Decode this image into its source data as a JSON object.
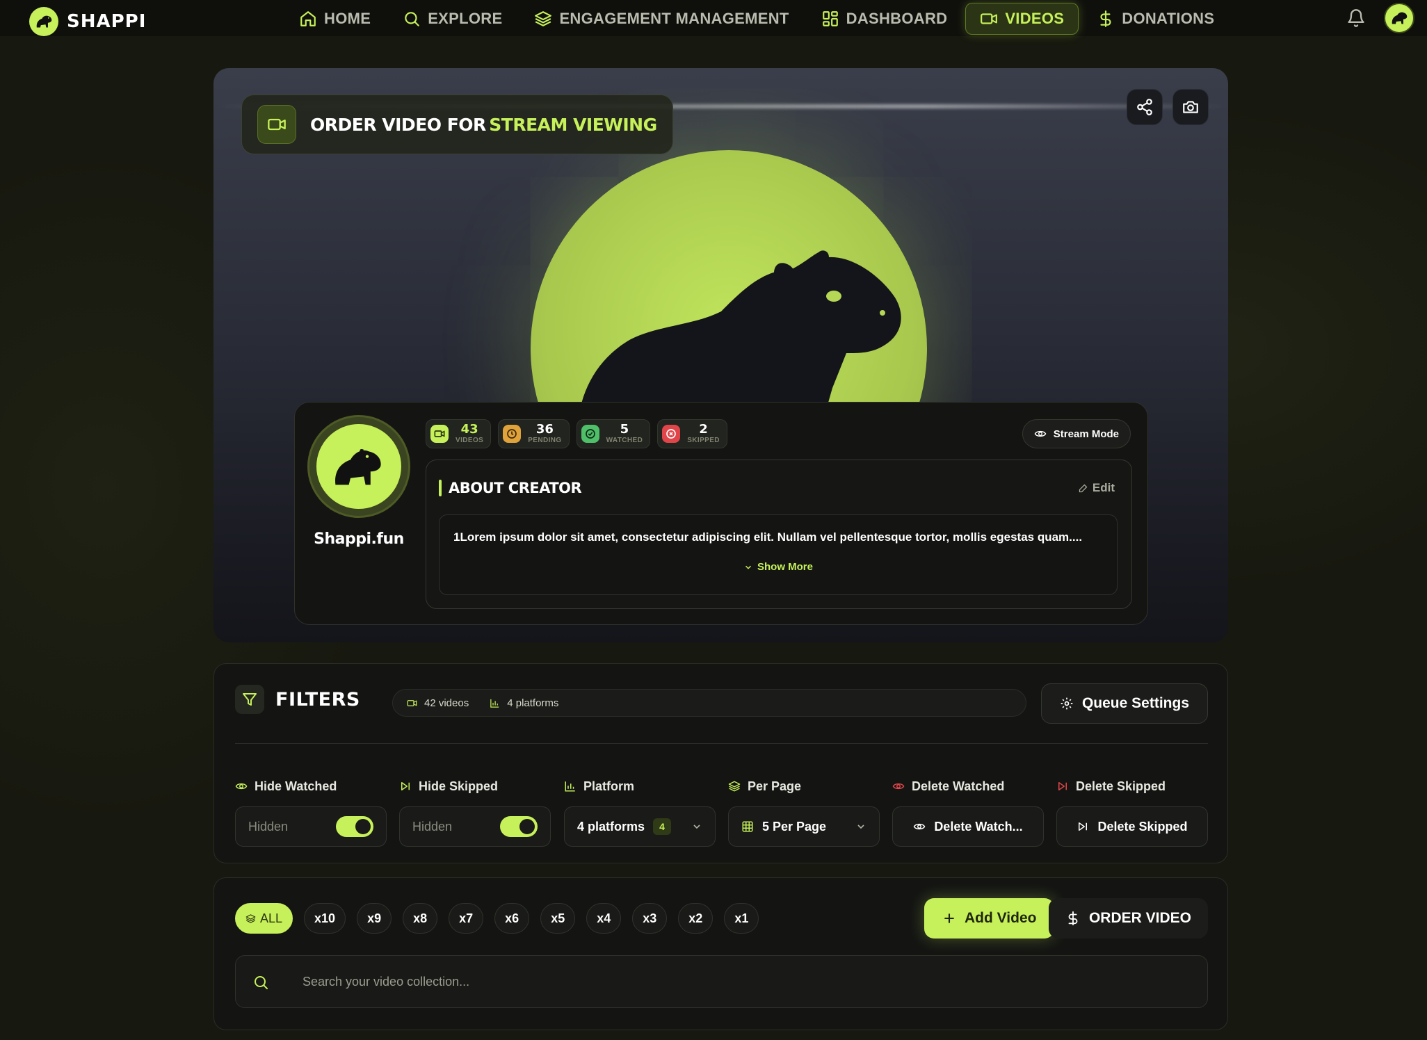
{
  "app": {
    "name": "SHAPPI"
  },
  "nav": {
    "items": [
      {
        "label": "HOME",
        "icon": "home-icon"
      },
      {
        "label": "EXPLORE",
        "icon": "search-icon"
      },
      {
        "label": "ENGAGEMENT MANAGEMENT",
        "icon": "layers-icon"
      },
      {
        "label": "DASHBOARD",
        "icon": "grid-icon"
      },
      {
        "label": "VIDEOS",
        "icon": "video-icon",
        "active": true
      },
      {
        "label": "DONATIONS",
        "icon": "dollar-icon"
      }
    ]
  },
  "hero": {
    "title_part1": "ORDER VIDEO FOR",
    "title_part2": "STREAM VIEWING"
  },
  "profile": {
    "name": "Shappi.fun",
    "stats": [
      {
        "value": "43",
        "label": "VIDEOS",
        "color": "#c6f15a"
      },
      {
        "value": "36",
        "label": "PENDING",
        "color": "#e0a23a"
      },
      {
        "value": "5",
        "label": "WATCHED",
        "color": "#4fbf6a"
      },
      {
        "value": "2",
        "label": "SKIPPED",
        "color": "#e0454a"
      }
    ],
    "stream_mode_label": "Stream Mode",
    "about_title": "ABOUT CREATOR",
    "edit_label": "Edit",
    "description": "1Lorem ipsum dolor sit amet, consectetur adipiscing elit. Nullam vel pellentesque tortor, mollis egestas quam....",
    "show_more_label": "Show More"
  },
  "filters": {
    "title": "FILTERS",
    "videos_count": "42 videos",
    "platforms_count": "4 platforms",
    "queue_settings_label": "Queue Settings",
    "hide_watched": {
      "label": "Hide Watched",
      "value": "Hidden"
    },
    "hide_skipped": {
      "label": "Hide Skipped",
      "value": "Hidden"
    },
    "platform": {
      "label": "Platform",
      "value": "4 platforms",
      "badge": "4"
    },
    "per_page": {
      "label": "Per Page",
      "value": "5 Per Page"
    },
    "delete_watched": {
      "label": "Delete Watched",
      "button": "Delete Watch..."
    },
    "delete_skipped": {
      "label": "Delete Skipped",
      "button": "Delete Skipped"
    }
  },
  "videos": {
    "chips": [
      "ALL",
      "x10",
      "x9",
      "x8",
      "x7",
      "x6",
      "x5",
      "x4",
      "x3",
      "x2",
      "x1"
    ],
    "add_video_label": "Add Video",
    "order_video_label": "ORDER VIDEO",
    "search_placeholder": "Search your video collection..."
  },
  "colors": {
    "accent": "#c6f15a",
    "background": "#17180f",
    "panel": "#141513"
  }
}
